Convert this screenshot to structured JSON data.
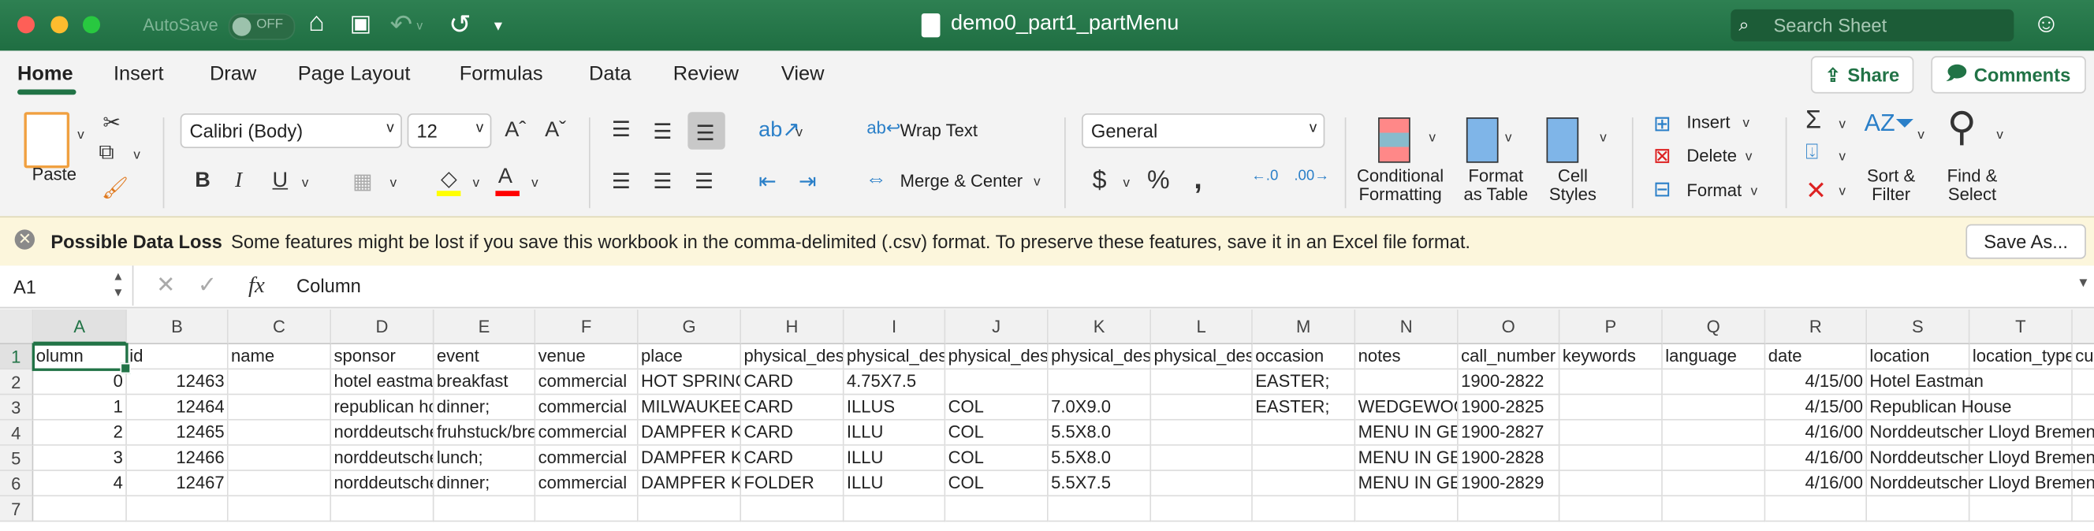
{
  "titlebar": {
    "autosave_label": "AutoSave",
    "autosave_state": "OFF",
    "document_title": "demo0_part1_partMenu",
    "search_placeholder": "Search Sheet"
  },
  "tabs": [
    "Home",
    "Insert",
    "Draw",
    "Page Layout",
    "Formulas",
    "Data",
    "Review",
    "View"
  ],
  "active_tab": "Home",
  "share_label": "Share",
  "comments_label": "Comments",
  "ribbon": {
    "paste": "Paste",
    "font_name": "Calibri (Body)",
    "font_size": "12",
    "wrap_text": "Wrap Text",
    "merge_center": "Merge & Center",
    "number_format": "General",
    "conditional_formatting": [
      "Conditional",
      "Formatting"
    ],
    "format_as_table": [
      "Format",
      "as Table"
    ],
    "cell_styles": [
      "Cell",
      "Styles"
    ],
    "insert": "Insert",
    "delete": "Delete",
    "format": "Format",
    "sort_filter": [
      "Sort &",
      "Filter"
    ],
    "find_select": [
      "Find &",
      "Select"
    ],
    "fill_color": "#ffff00",
    "font_color": "#ff0000"
  },
  "message_bar": {
    "title": "Possible Data Loss",
    "text": "Some features might be lost if you save this workbook in the comma-delimited (.csv) format. To preserve these features, save it in an Excel file format.",
    "button": "Save As..."
  },
  "formula_bar": {
    "name_box": "A1",
    "value": "Column"
  },
  "sheet": {
    "selected_cell": "A1",
    "columns": [
      "A",
      "B",
      "C",
      "D",
      "E",
      "F",
      "G",
      "H",
      "I",
      "J",
      "K",
      "L",
      "M",
      "N",
      "O",
      "P",
      "Q",
      "R",
      "S",
      "T",
      ""
    ],
    "row_numbers": [
      "1",
      "2",
      "3",
      "4",
      "5",
      "6",
      "7"
    ],
    "rows": [
      [
        "olumn",
        "id",
        "name",
        "sponsor",
        "event",
        "venue",
        "place",
        "physical_des",
        "physical_des",
        "physical_des",
        "physical_des",
        "physical_des",
        "occasion",
        "notes",
        "call_number",
        "keywords",
        "language",
        "date",
        "location",
        "location_type",
        "cu"
      ],
      [
        "0",
        "12463",
        "",
        "hotel eastman",
        "breakfast",
        "commercial",
        "HOT SPRINGS",
        "CARD",
        "4.75X7.5",
        "",
        "",
        "",
        "EASTER;",
        "",
        "1900-2822",
        "",
        "",
        "4/15/00",
        "Hotel Eastman",
        "",
        ""
      ],
      [
        "1",
        "12464",
        "",
        "republican house",
        "dinner;",
        "commercial",
        "MILWAUKEE",
        "CARD",
        "ILLUS",
        "COL",
        "7.0X9.0",
        "",
        "EASTER;",
        "WEDGEWOOD",
        "1900-2825",
        "",
        "",
        "4/15/00",
        "Republican House",
        "",
        ""
      ],
      [
        "2",
        "12465",
        "",
        "norddeutscher",
        "fruhstuck/breakfast",
        "commercial",
        "DAMPFER KAISER",
        "CARD",
        "ILLU",
        "COL",
        "5.5X8.0",
        "",
        "",
        "MENU IN GERMAN",
        "1900-2827",
        "",
        "",
        "4/16/00",
        "Norddeutscher Lloyd Bremen",
        "",
        ""
      ],
      [
        "3",
        "12466",
        "",
        "norddeutscher",
        "lunch;",
        "commercial",
        "DAMPFER KAISER",
        "CARD",
        "ILLU",
        "COL",
        "5.5X8.0",
        "",
        "",
        "MENU IN GERMAN",
        "1900-2828",
        "",
        "",
        "4/16/00",
        "Norddeutscher Lloyd Bremen",
        "",
        ""
      ],
      [
        "4",
        "12467",
        "",
        "norddeutscher",
        "dinner;",
        "commercial",
        "DAMPFER KAISER",
        "FOLDER",
        "ILLU",
        "COL",
        "5.5X7.5",
        "",
        "",
        "MENU IN GERMAN",
        "1900-2829",
        "",
        "",
        "4/16/00",
        "Norddeutscher Lloyd Bremen",
        "",
        ""
      ],
      [
        "",
        "",
        "",
        "",
        "",
        "",
        "",
        "",
        "",
        "",
        "",
        "",
        "",
        "",
        "",
        "",
        "",
        "",
        "",
        "",
        ""
      ]
    ]
  }
}
